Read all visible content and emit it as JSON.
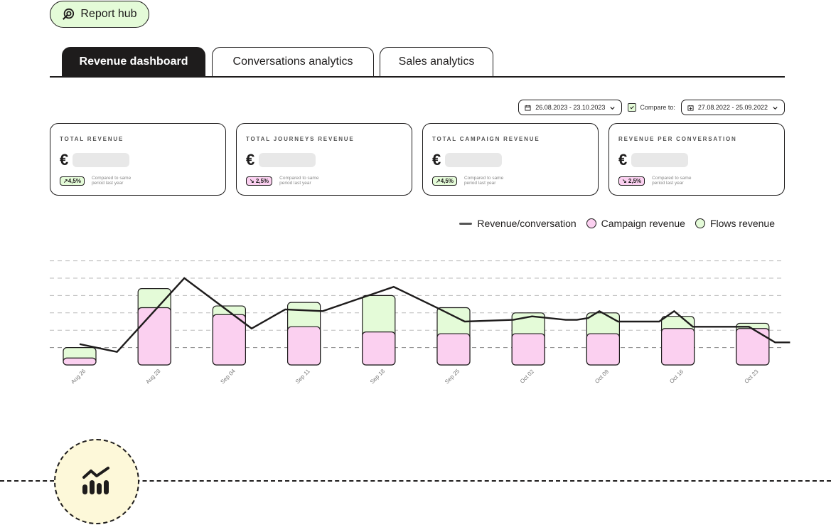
{
  "report_hub": {
    "label": "Report hub",
    "icon": "report-hub-icon"
  },
  "tabs": [
    {
      "label": "Revenue dashboard",
      "active": true
    },
    {
      "label": "Conversations analytics",
      "active": false
    },
    {
      "label": "Sales analytics",
      "active": false
    }
  ],
  "filters": {
    "date_range": "26.08.2023 - 23.10.2023",
    "compare_label": "Compare to:",
    "compare_checked": true,
    "compare_range": "27.08.2022 - 25.09.2022"
  },
  "cards": [
    {
      "title": "TOTAL REVENUE",
      "currency": "€",
      "change": "↗4,5%",
      "trend": "up",
      "note": "Compared to same period last year"
    },
    {
      "title": "TOTAL JOURNEYS REVENUE",
      "currency": "€",
      "change": "↘ 2,5%",
      "trend": "down",
      "note": "Compared to same period last year"
    },
    {
      "title": "TOTAL CAMPAIGN REVENUE",
      "currency": "€",
      "change": "↗4,5%",
      "trend": "up",
      "note": "Compared to same period last year"
    },
    {
      "title": "REVENUE PER CONVERSATION",
      "currency": "€",
      "change": "↘ 2,5%",
      "trend": "down",
      "note": "Compared to same period last year"
    }
  ],
  "colors": {
    "campaign": "#fbd0f0",
    "flows": "#e4fbd8",
    "line": "#1e1c1c",
    "accent_yellow": "#fdf8d9"
  },
  "chart_data": {
    "type": "bar",
    "stacked": true,
    "title": "",
    "xlabel": "",
    "ylabel": "",
    "grid": true,
    "ylim": [
      0,
      6
    ],
    "legend_position": "top-right",
    "legend": [
      "Revenue/conversation",
      "Campaign revenue",
      "Flows revenue"
    ],
    "categories": [
      "Aug 26",
      "Aug 28",
      "Sep 04",
      "Sep 11",
      "Sep 18",
      "Sep 25",
      "Oct 02",
      "Oct 09",
      "Oct 16",
      "Oct 23"
    ],
    "series": [
      {
        "name": "Campaign revenue",
        "values": [
          0.4,
          3.3,
          2.9,
          2.2,
          1.9,
          1.8,
          1.8,
          1.8,
          2.1,
          2.1
        ]
      },
      {
        "name": "Flows revenue",
        "values": [
          0.6,
          1.1,
          0.5,
          1.4,
          2.1,
          1.5,
          1.2,
          1.2,
          0.7,
          0.3
        ]
      }
    ],
    "line_series": {
      "name": "Revenue/conversation",
      "points": [
        [
          0.0,
          1.2
        ],
        [
          0.5,
          0.75
        ],
        [
          1.4,
          5.0
        ],
        [
          2.3,
          2.1
        ],
        [
          2.75,
          3.2
        ],
        [
          3.25,
          3.1
        ],
        [
          4.2,
          4.5
        ],
        [
          4.8,
          3.25
        ],
        [
          5.15,
          2.5
        ],
        [
          5.8,
          2.6
        ],
        [
          6.05,
          2.8
        ],
        [
          6.5,
          2.6
        ],
        [
          6.65,
          2.6
        ],
        [
          6.8,
          2.7
        ],
        [
          6.95,
          3.1
        ],
        [
          7.2,
          2.5
        ],
        [
          7.75,
          2.5
        ],
        [
          7.95,
          3.1
        ],
        [
          8.2,
          2.2
        ],
        [
          8.95,
          2.2
        ],
        [
          9.3,
          1.3
        ],
        [
          9.5,
          1.3
        ]
      ]
    }
  }
}
